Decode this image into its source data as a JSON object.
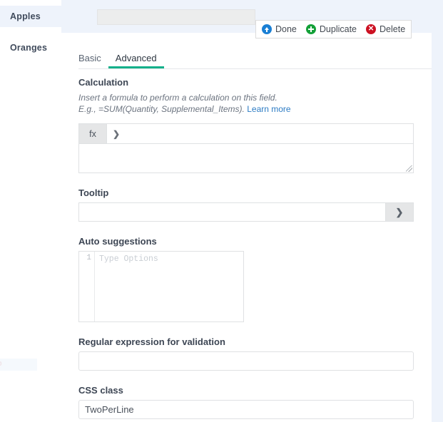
{
  "sidebar": {
    "items": [
      {
        "label": "Apples",
        "selected": true
      },
      {
        "label": "Oranges",
        "selected": false
      }
    ],
    "ghost_label": "p"
  },
  "header": {
    "title_field_value": "",
    "actions": [
      {
        "label": "Done",
        "icon": "circle-up-arrow-icon",
        "color": "#1a7fd4"
      },
      {
        "label": "Duplicate",
        "icon": "circle-plus-icon",
        "color": "#14a038"
      },
      {
        "label": "Delete",
        "icon": "circle-x-icon",
        "color": "#cc1122",
        "glyph": "✕"
      }
    ]
  },
  "tabs": [
    {
      "label": "Basic",
      "active": false
    },
    {
      "label": "Advanced",
      "active": true
    }
  ],
  "form": {
    "calculation": {
      "title": "Calculation",
      "hint_line_1": "Insert a formula to perform a calculation on this field.",
      "hint_line_2": "E.g., =SUM(Quantity, Supplemental_Items).",
      "learn_more": "Learn more",
      "fx_label": "fx",
      "chevron": "❯",
      "formula_value": ""
    },
    "tooltip": {
      "label": "Tooltip",
      "value": "",
      "placeholder": "",
      "button_glyph": "❯"
    },
    "auto_suggestions": {
      "label": "Auto suggestions",
      "line_number": "1",
      "placeholder": "Type Options",
      "value": ""
    },
    "regex": {
      "label": "Regular expression for validation",
      "value": "",
      "placeholder": ""
    },
    "css_class": {
      "label": "CSS class",
      "value": "TwoPerLine",
      "placeholder": ""
    }
  },
  "theme": {
    "accent": "#14b08a",
    "page_bg": "#eef3fb",
    "panel_bg": "#ffffff",
    "link": "#2d7cc4"
  }
}
